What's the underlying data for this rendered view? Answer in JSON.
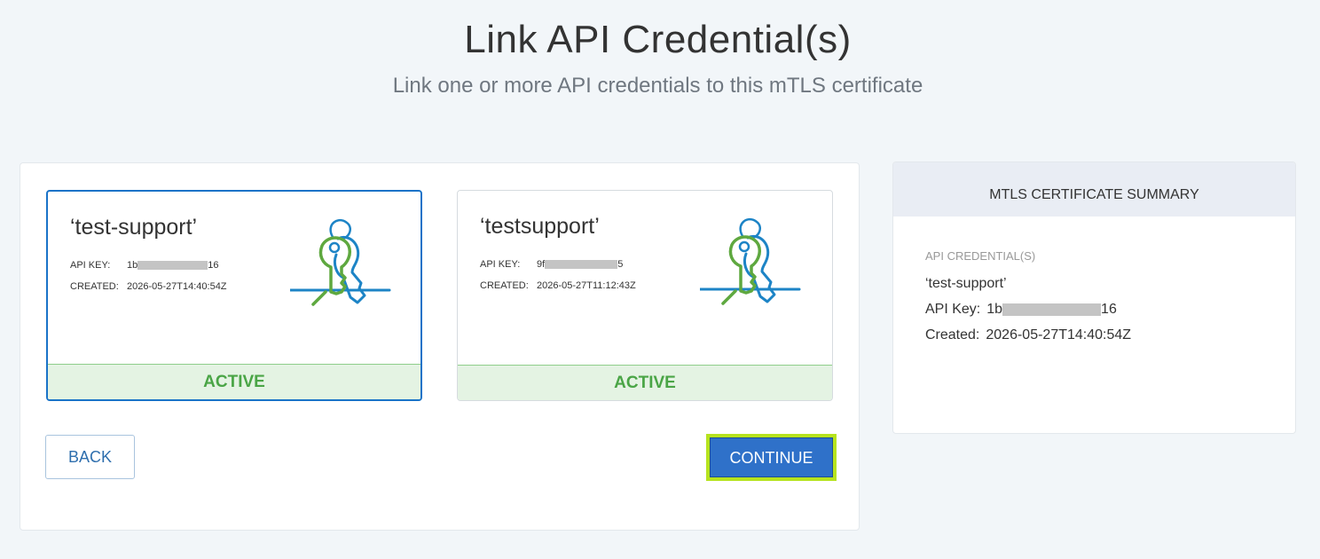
{
  "header": {
    "title": "Link API Credential(s)",
    "subtitle": "Link one or more API credentials to this mTLS certificate"
  },
  "credentials": [
    {
      "name": "‘test-support’",
      "api_key_label": "API KEY:",
      "api_key_prefix": "1b",
      "api_key_suffix": "16",
      "created_label": "CREATED:",
      "created": "2026-05-27T14:40:54Z",
      "status": "ACTIVE",
      "selected": true
    },
    {
      "name": "‘testsupport’",
      "api_key_label": "API KEY:",
      "api_key_prefix": "9f",
      "api_key_suffix": "5",
      "created_label": "CREATED:",
      "created": "2026-05-27T11:12:43Z",
      "status": "ACTIVE",
      "selected": false
    }
  ],
  "buttons": {
    "back": "BACK",
    "continue": "CONTINUE"
  },
  "summary": {
    "title": "MTLS CERTIFICATE SUMMARY",
    "section_label": "API CREDENTIAL(S)",
    "name": "‘test-support’",
    "api_key_label": "API Key:",
    "api_key_prefix": "1b",
    "api_key_suffix": "16",
    "created_label": "Created:",
    "created": "2026-05-27T14:40:54Z"
  },
  "colors": {
    "accent": "#1a73c8",
    "continue_bg": "#2f71c9",
    "continue_highlight": "#b6e31e",
    "active_text": "#4aa546",
    "active_bg": "#e4f3e3",
    "key_green": "#5ea83f",
    "key_blue": "#1d84c6"
  },
  "icons": {
    "credential_illustration": "keys-icon"
  }
}
